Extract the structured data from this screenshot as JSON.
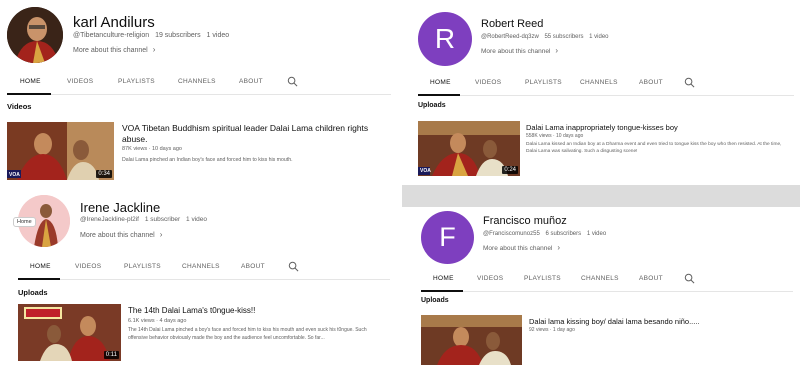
{
  "tabs": [
    "HOME",
    "VIDEOS",
    "PLAYLISTS",
    "CHANNELS",
    "ABOUT"
  ],
  "more_about": "More about this channel",
  "colors": {
    "avatar_purple": "#7e3fbf",
    "tab_active": "#0f0f0f",
    "muted": "#606060",
    "band": "#dcdcdc"
  },
  "panels": {
    "karl": {
      "name": "karl Andilurs",
      "handle": "@Tibetanculture-religion",
      "subs": "19 subscribers",
      "videos": "1 video",
      "section": "Videos",
      "video": {
        "title": "VOA Tibetan Buddhism spiritual leader Dalai Lama children rights abuse.",
        "views": "87K views",
        "age": "10 days ago",
        "desc": "Dalai Lama pinched an Indian boy's face and forced him to kiss his mouth.",
        "duration": "0:34",
        "channel_logo": "VOA"
      }
    },
    "robert": {
      "letter": "R",
      "name": "Robert Reed",
      "handle": "@RobertReed-dq3zw",
      "subs": "55 subscribers",
      "videos": "1 video",
      "section": "Uploads",
      "video": {
        "title": "Dalai Lama inappropriately tongue-kisses boy",
        "views": "558K views",
        "age": "10 days ago",
        "desc": "Dalai Lama kissed an Indian boy at a Dharma event and even tried to tongue kiss the boy who then resisted. At the time, Dalai Lama was salivating. Such a disgusting scene!",
        "duration": "0:24",
        "channel_logo": "VOA"
      }
    },
    "irene": {
      "name": "Irene Jackline",
      "handle": "@IreneJackline-pl2if",
      "subs": "1 subscriber",
      "videos": "1 video",
      "home_badge": "Home",
      "section": "Uploads",
      "video": {
        "title": "The 14th Dalai Lama's t0ngue-kiss!!",
        "views": "6.1K views",
        "age": "4 days ago",
        "desc": "The 14th Dalai Lama pinched a boy's face and forced him to kiss his mouth and even suck his t0ngue. Such offensive behavior obviously made the boy and the audience feel uncomfortable. So far...",
        "duration": "0:11"
      }
    },
    "francisco": {
      "letter": "F",
      "name": "Francisco muñoz",
      "handle": "@Franciscomunoz55",
      "subs": "6 subscribers",
      "videos": "1 video",
      "section": "Uploads",
      "video": {
        "title": "Dalai lama kissing boy/ dalai lama besando niño.....",
        "views": "92 views",
        "age": "1 day ago"
      }
    }
  }
}
